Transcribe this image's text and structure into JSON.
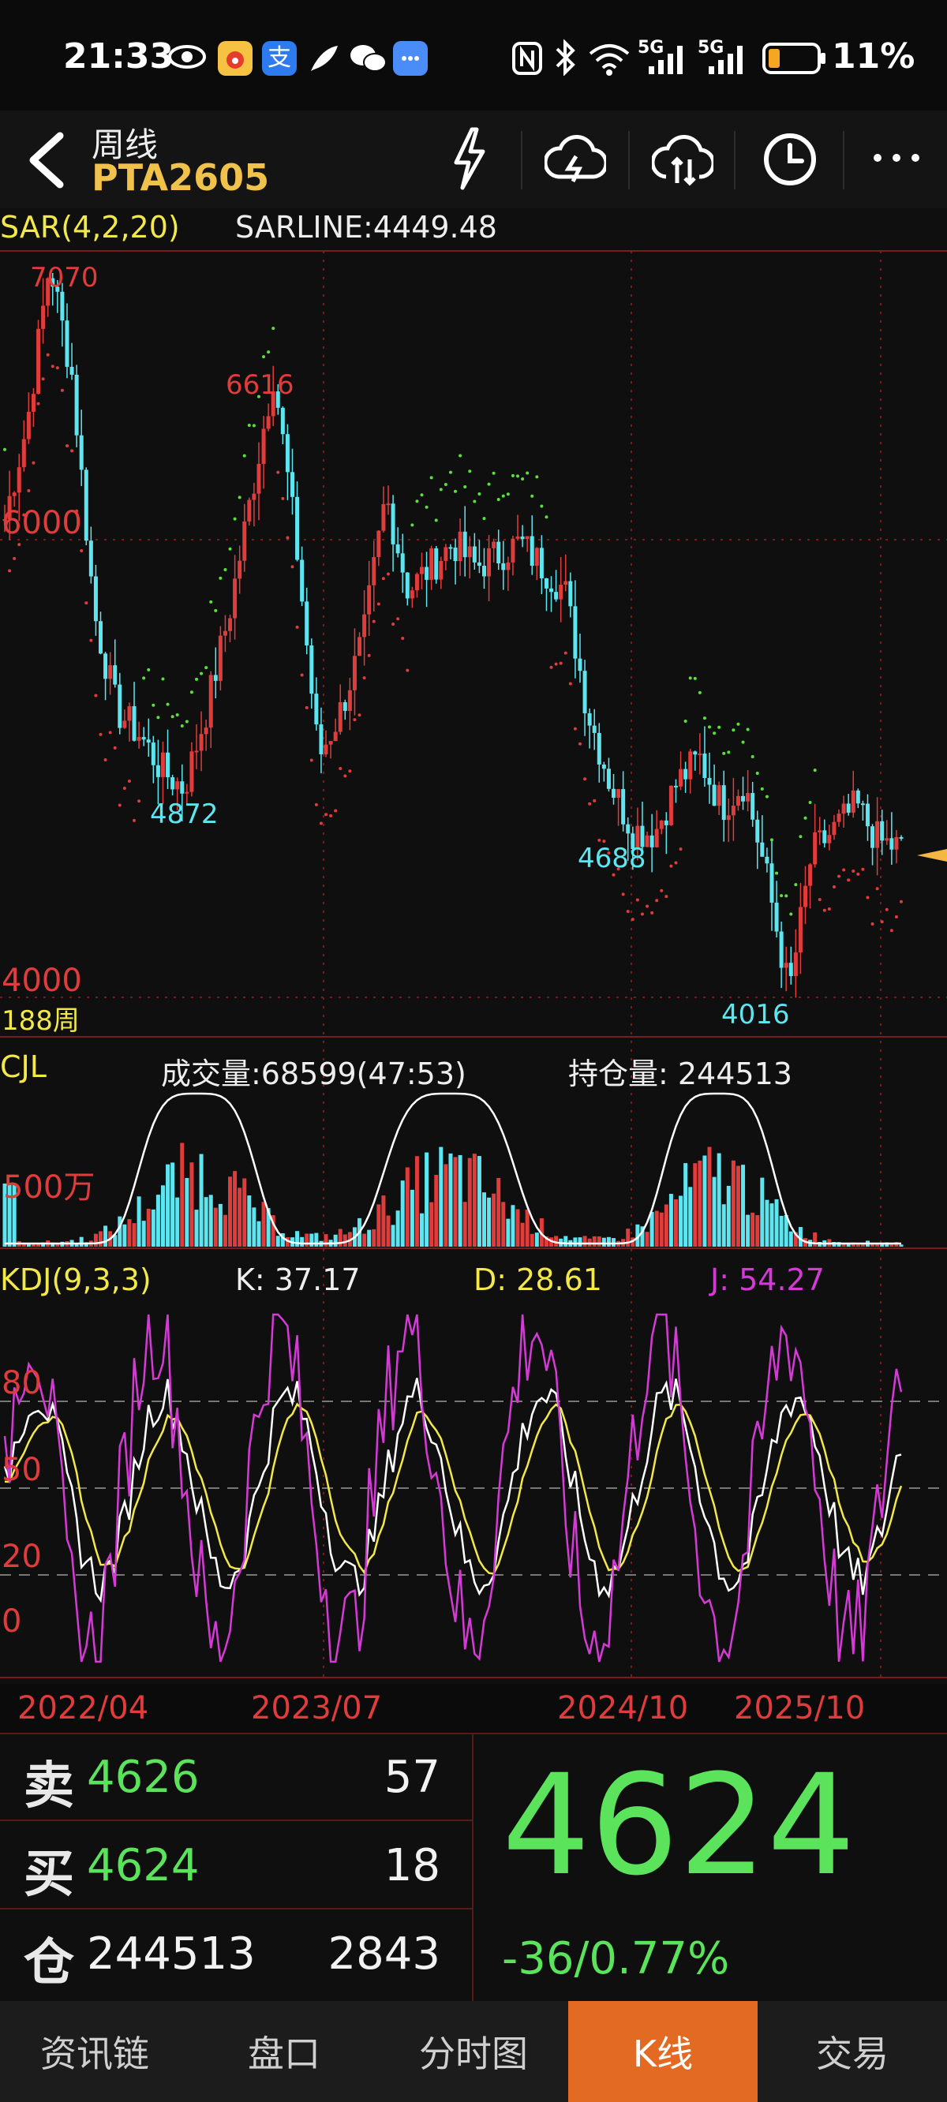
{
  "status_bar": {
    "time": "21:33",
    "network_5g_1": "5G",
    "network_5g_2": "5G",
    "battery": "11%"
  },
  "header": {
    "period": "周线",
    "symbol": "PTA2605",
    "icons": [
      "back-icon",
      "flash-icon",
      "cloud-lightning-icon",
      "cloud-sync-icon",
      "clock-icon",
      "more-icon"
    ]
  },
  "main_panel": {
    "indicator": "SAR(4,2,20)",
    "sarline": "SARLINE:4449.48",
    "y_label_top": "6000",
    "y_label_bottom": "4000",
    "period_count": "188周",
    "annotations": {
      "high1": "7070",
      "high2": "6616",
      "low1": "4872",
      "low2": "4688",
      "low3": "4016"
    }
  },
  "volume_panel": {
    "indicator": "CJL",
    "volume": "成交量:68599(47:53)",
    "open_interest": "持仓量: 244513",
    "scale_label": "500万"
  },
  "kdj_panel": {
    "indicator": "KDJ(9,3,3)",
    "k": "K: 37.17",
    "d": "D: 28.61",
    "j": "J: 54.27",
    "levels": [
      "80",
      "50",
      "20",
      "0"
    ]
  },
  "x_axis": [
    "2022/04",
    "2023/07",
    "2024/10",
    "2025/10"
  ],
  "quote": {
    "sell_label": "卖",
    "sell_price": "4626",
    "sell_volume": "57",
    "buy_label": "买",
    "buy_price": "4624",
    "buy_volume": "18",
    "oi_label": "仓",
    "oi_value": "244513",
    "oi_change": "2843",
    "last_price": "4624",
    "change": "-36/0.77%"
  },
  "tabs": [
    "资讯链",
    "盘口",
    "分时图",
    "K线",
    "交易"
  ],
  "active_tab": "K线",
  "colors": {
    "up": "#e03c3c",
    "down": "#5ee6f0",
    "green": "#5ce35c",
    "yellow": "#f2e84a",
    "magenta": "#d63ad6",
    "orange": "#e36a22",
    "sar": "#59e33a"
  },
  "chart_data": {
    "type": "candlestick",
    "main_ylim": [
      4000,
      7100
    ],
    "close_approx": [
      6000,
      6400,
      7070,
      6600,
      5600,
      5200,
      5100,
      4950,
      4872,
      5200,
      5600,
      6100,
      6616,
      5900,
      5000,
      5200,
      5500,
      6100,
      5700,
      5800,
      5900,
      5800,
      5850,
      5900,
      5800,
      5700,
      5200,
      4900,
      4700,
      4688,
      4900,
      5000,
      4800,
      4900,
      4500,
      4016,
      4600,
      4700,
      4800,
      4650,
      4624
    ]
  }
}
